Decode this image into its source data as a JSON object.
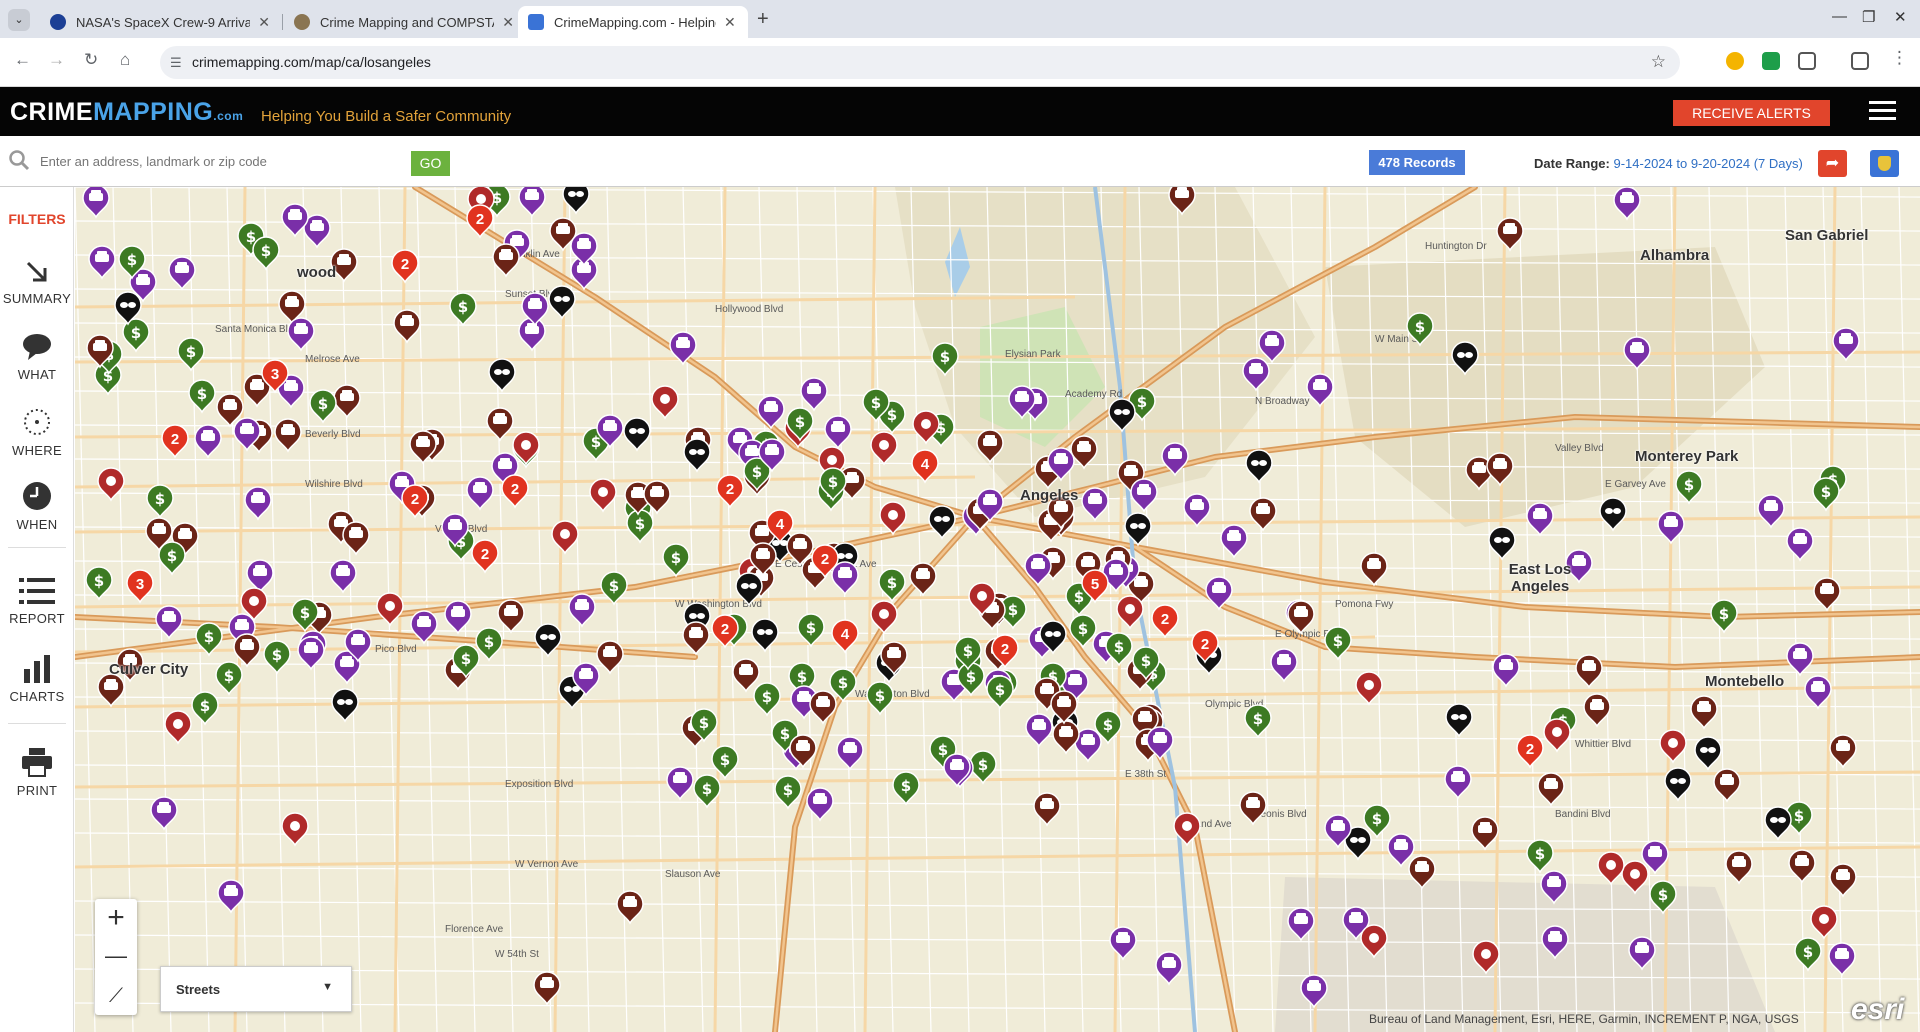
{
  "browser": {
    "tabs": [
      {
        "title": "NASA's SpaceX Crew-9 Arrival",
        "close": "✕"
      },
      {
        "title": "Crime Mapping and COMPSTAT",
        "close": "✕"
      },
      {
        "title": "CrimeMapping.com - Helping Y",
        "close": "✕"
      }
    ],
    "new_tab": "+",
    "url": "crimemapping.com/map/ca/losangeles",
    "window_controls": [
      "—",
      "❐",
      "✕"
    ]
  },
  "header": {
    "logo_a": "CRIME",
    "logo_b": "MAPPING",
    "logo_c": ".com",
    "tagline": "Helping You Build a Safer Community",
    "receive_alerts": "RECEIVE ALERTS"
  },
  "search": {
    "placeholder": "Enter an address, landmark or zip code",
    "go": "GO",
    "records": "478 Records",
    "date_label": "Date Range:",
    "date_value": "9-14-2024 to 9-20-2024 (7 Days)"
  },
  "sidebar": {
    "filters": "FILTERS",
    "items": [
      {
        "label": "SUMMARY",
        "icon": "arrow-down-right-icon"
      },
      {
        "label": "WHAT",
        "icon": "speech-bubble-icon"
      },
      {
        "label": "WHERE",
        "icon": "dotted-circle-icon"
      },
      {
        "label": "WHEN",
        "icon": "clock-icon"
      },
      {
        "label": "REPORT",
        "icon": "list-icon"
      },
      {
        "label": "CHARTS",
        "icon": "bar-chart-icon"
      },
      {
        "label": "PRINT",
        "icon": "printer-icon"
      }
    ]
  },
  "map": {
    "place_labels": [
      "Alhambra",
      "San Gabriel",
      "Monterey Park",
      "East Los Angeles",
      "Montebello",
      "Culver City",
      "Angeles",
      "wood"
    ],
    "street_labels": [
      "Melrose Ave",
      "Beverly Blvd",
      "Wilshire Blvd",
      "Venice Blvd",
      "W Washington Blvd",
      "Pico Blvd",
      "Olympic Blvd",
      "Exposition Blvd",
      "W Vernon Ave",
      "W 54th St",
      "Sunset Blvd",
      "Franklin Ave",
      "Santa Monica Blvd",
      "Hollywood Blvd",
      "N Broadway",
      "W Main St",
      "E Garvey Ave",
      "Valley Blvd",
      "Huntington Dr",
      "E Cesar E Chavez Ave",
      "Whittier Blvd",
      "Washington Blvd",
      "E 38th St",
      "Slauson Ave",
      "Florence Ave",
      "E Olympic Blvd",
      "Pomona Fwy",
      "Elysian Park",
      "Academy Rd",
      "E Grand Ave",
      "Leonis Blvd",
      "Bandini Blvd"
    ],
    "basemap": "Streets",
    "zoom_in": "+",
    "zoom_out": "—",
    "attribution": "Bureau of Land Management, Esri, HERE, Garmin, INCREMENT P, NGA, USGS",
    "esri": "esri",
    "marker_colors": {
      "vehicle": "#7a2fa8",
      "theft": "#3d7a23",
      "burglary": "#6b2417",
      "cluster": "#e1331f",
      "assault": "#b02a2a",
      "vandalism": "#111111"
    },
    "cluster_counts": [
      "2",
      "2",
      "3",
      "2",
      "2",
      "2",
      "4",
      "2",
      "3",
      "2",
      "5",
      "2",
      "4",
      "2",
      "2",
      "2",
      "2",
      "4",
      "2"
    ]
  }
}
